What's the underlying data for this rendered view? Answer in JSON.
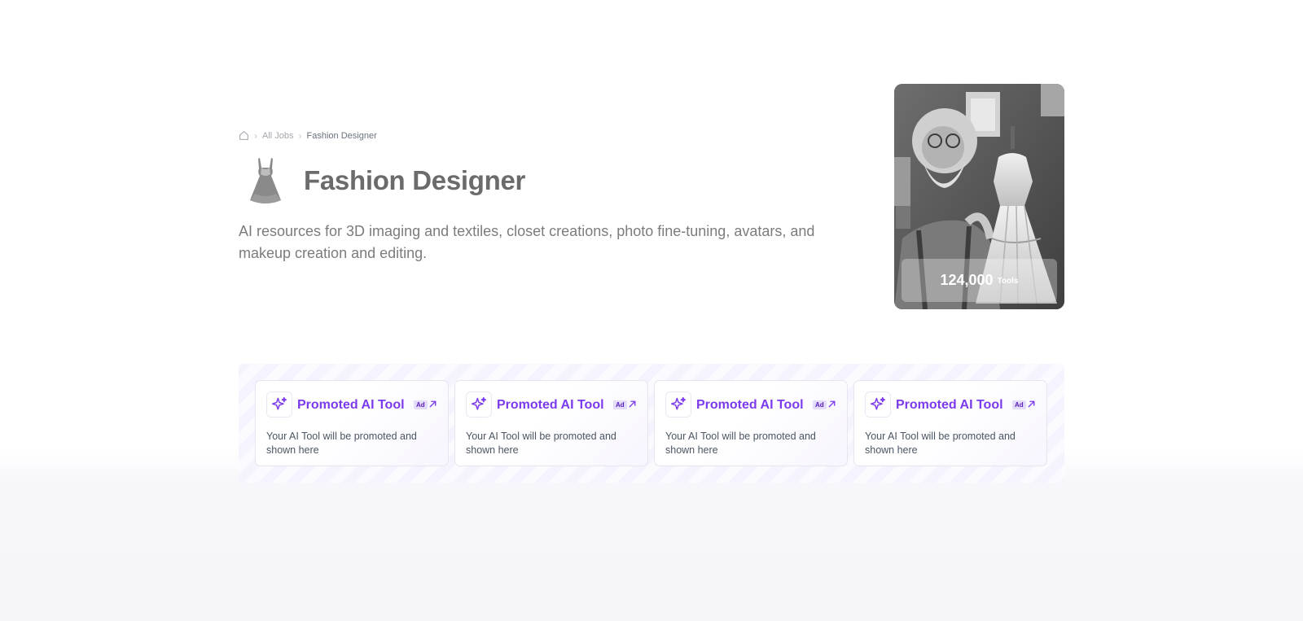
{
  "breadcrumb": {
    "home_icon": "home-icon",
    "separator_icon": "chevron-right-icon",
    "items": [
      "All Jobs",
      "Fashion Designer"
    ]
  },
  "header": {
    "icon": "dress-icon",
    "title": "Fashion Designer",
    "description": "AI resources for 3D imaging and textiles, closet creations, photo fine-tuning, avatars, and makeup creation and editing."
  },
  "hero_image": {
    "tools_count": "124,000",
    "tools_label": "Tools"
  },
  "promoted": {
    "accent_color": "#7c3aed",
    "cards": [
      {
        "icon": "sparkles-icon",
        "title": "Promoted AI Tool",
        "badge": "Ad",
        "link_icon": "arrow-up-right-icon",
        "description": "Your AI Tool will be promoted and shown here"
      },
      {
        "icon": "sparkles-icon",
        "title": "Promoted AI Tool",
        "badge": "Ad",
        "link_icon": "arrow-up-right-icon",
        "description": "Your AI Tool will be promoted and shown here"
      },
      {
        "icon": "sparkles-icon",
        "title": "Promoted AI Tool",
        "badge": "Ad",
        "link_icon": "arrow-up-right-icon",
        "description": "Your AI Tool will be promoted and shown here"
      },
      {
        "icon": "sparkles-icon",
        "title": "Promoted AI Tool",
        "badge": "Ad",
        "link_icon": "arrow-up-right-icon",
        "description": "Your AI Tool will be promoted and shown here"
      }
    ]
  }
}
